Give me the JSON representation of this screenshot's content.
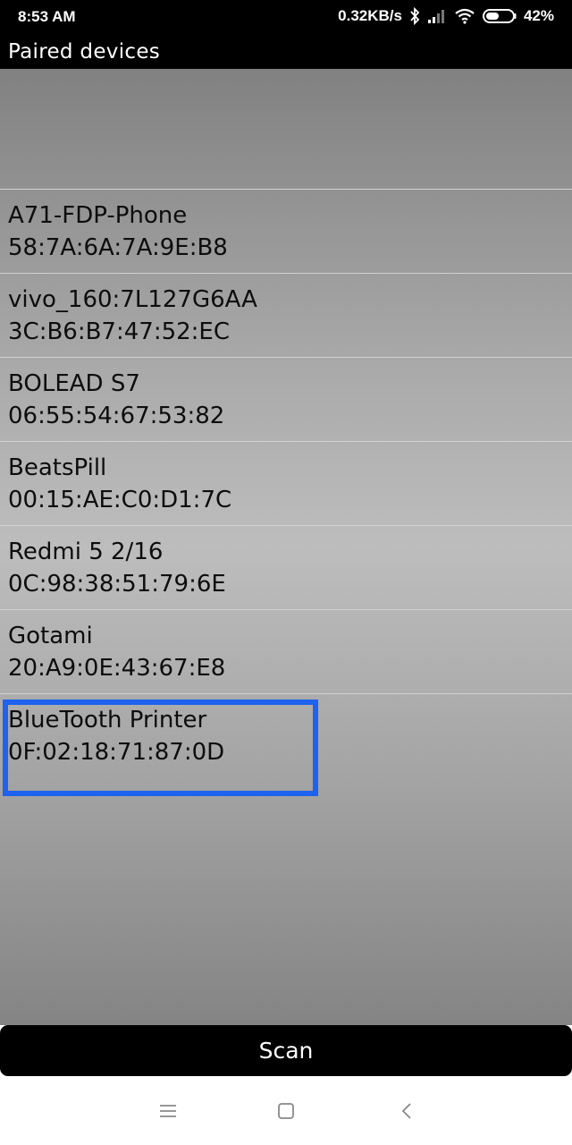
{
  "status_bar": {
    "time": "8:53 AM",
    "network_speed": "0.32KB/s",
    "battery": "42%",
    "icons": [
      "bluetooth-icon",
      "signal-icon",
      "wifi-icon",
      "battery-icon"
    ]
  },
  "title": "Paired devices",
  "devices": [
    {
      "name": "A71-FDP-Phone",
      "mac": "58:7A:6A:7A:9E:B8"
    },
    {
      "name": "vivo_160:7L127G6AA",
      "mac": "3C:B6:B7:47:52:EC"
    },
    {
      "name": "BOLEAD S7",
      "mac": "06:55:54:67:53:82"
    },
    {
      "name": "BeatsPill",
      "mac": "00:15:AE:C0:D1:7C"
    },
    {
      "name": "Redmi 5 2/16",
      "mac": "0C:98:38:51:79:6E"
    },
    {
      "name": "Gotami",
      "mac": "20:A9:0E:43:67:E8"
    },
    {
      "name": "BlueTooth Printer",
      "mac": "0F:02:18:71:87:0D"
    }
  ],
  "scan_button": {
    "label": "Scan"
  },
  "nav": {
    "icons": [
      "menu-icon",
      "home-icon",
      "back-icon"
    ]
  },
  "colors": {
    "highlight": "#1e62ee",
    "bar_background": "#000000"
  }
}
